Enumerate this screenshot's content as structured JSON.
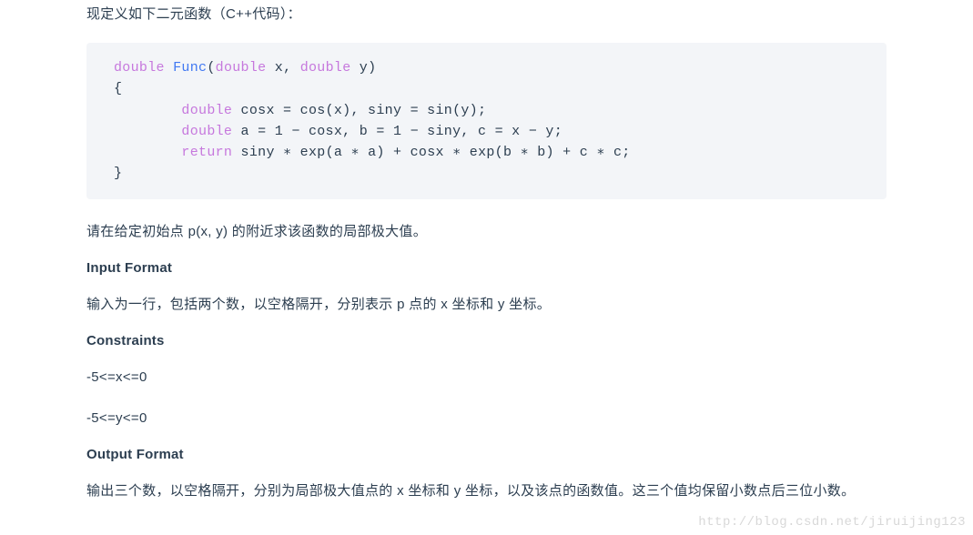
{
  "intro": "现定义如下二元函数（C++代码）：",
  "code": {
    "l1": {
      "kw": "double",
      "fn": "Func",
      "rest": "(",
      "kw2": "double",
      "mid": " x, ",
      "kw3": "double",
      "end": " y)"
    },
    "l2": "{",
    "l3": {
      "pad": "        ",
      "kw": "double",
      "rest": " cosx = cos(x), siny = sin(y);"
    },
    "l4": {
      "pad": "        ",
      "kw": "double",
      "rest": " a = 1 − cosx, b = 1 − siny, c = x − y;"
    },
    "l5": {
      "pad": "        ",
      "kw": "return",
      "rest": " siny ∗ exp(a ∗ a) + cosx ∗ exp(b ∗ b) + c ∗ c;"
    },
    "l6": "}"
  },
  "task": "请在给定初始点 p(x, y) 的附近求该函数的局部极大值。",
  "headings": {
    "input": "Input Format",
    "constraints": "Constraints",
    "output": "Output Format"
  },
  "input_desc": "输入为一行，包括两个数，以空格隔开，分别表示 p 点的 x 坐标和 y 坐标。",
  "constraints": {
    "c1": "-5<=x<=0",
    "c2": "-5<=y<=0"
  },
  "output_desc": "输出三个数，以空格隔开，分别为局部极大值点的 x 坐标和 y 坐标，以及该点的函数值。这三个值均保留小数点后三位小数。",
  "watermark": "http://blog.csdn.net/jiruijing123"
}
